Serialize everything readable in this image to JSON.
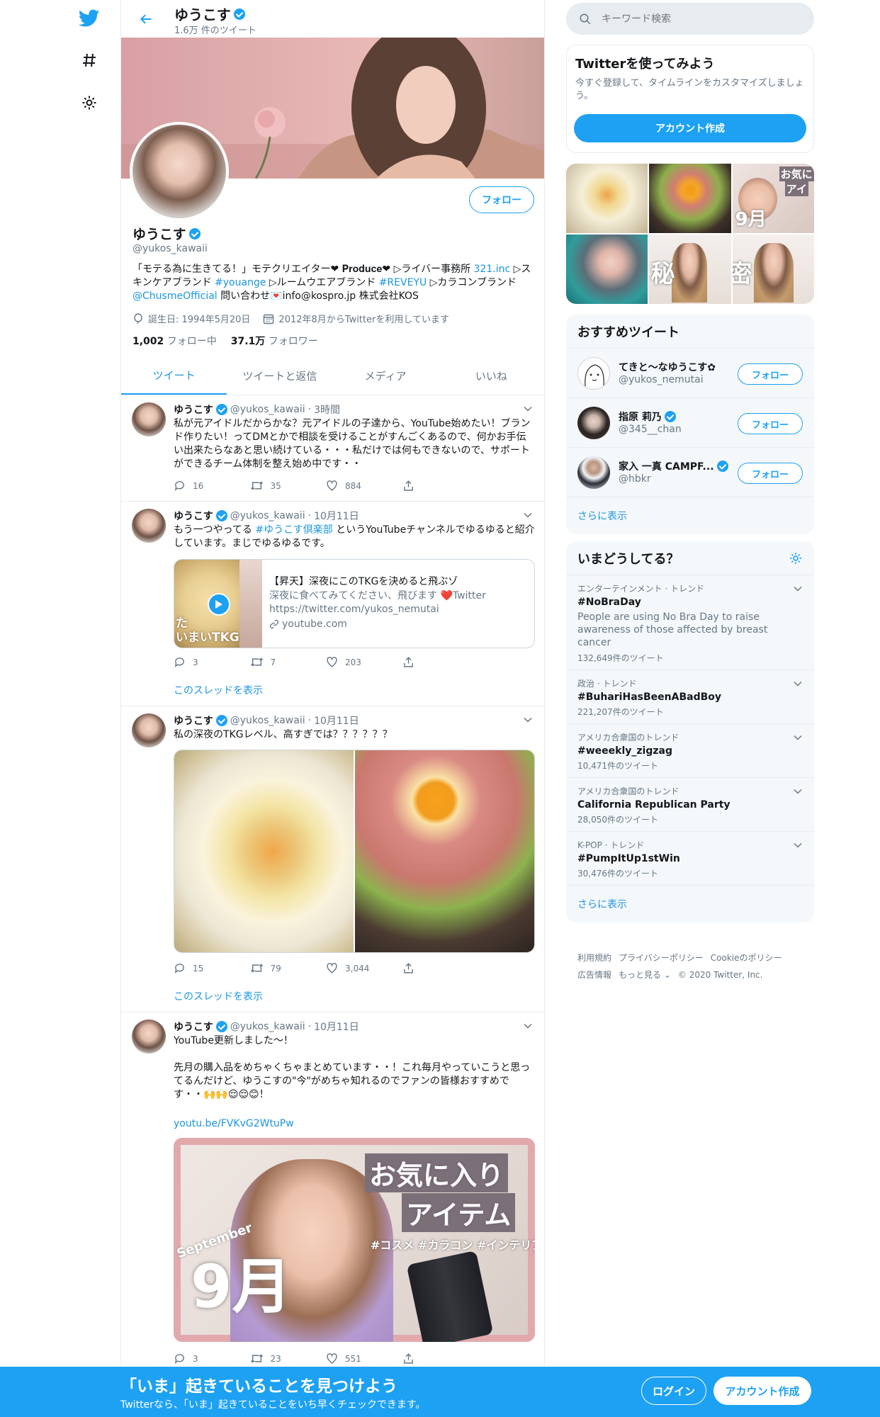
{
  "colors": {
    "accent": "#1da1f2",
    "link": "#1b95e0",
    "muted": "#657786",
    "border": "#e6ecf0"
  },
  "nav": {
    "icons": [
      "twitter-bird-icon",
      "hashtag-icon",
      "gear-icon"
    ]
  },
  "header": {
    "name": "ゆうこす",
    "tweet_count": "1.6万 件のツイート"
  },
  "profile": {
    "name": "ゆうこす",
    "handle": "@yukos_kawaii",
    "follow_label": "フォロー",
    "bio": {
      "p1": "「モテる為に生きてる！」モテクリエイター❤ 𝐏𝐫𝐨𝐝𝐮𝐜𝐞❤ ▷ライバー事務所 ",
      "l1": "321.inc",
      "p2": " ▷スキンケアブランド ",
      "l2": "#youange",
      "p3": " ▷ルームウエアブランド ",
      "l3": "#REVEYU",
      "p4": " ▷カラコンブランド ",
      "l4": "@ChusmeOfficial",
      "p5": " 問い合わせ💌info@kospro.jp 株式会社KOS"
    },
    "birthday": "誕生日: 1994年5月20日",
    "joined": "2012年8月からTwitterを利用しています",
    "following_count": "1,002",
    "following_label": "フォロー中",
    "followers_count": "37.1万",
    "followers_label": "フォロワー"
  },
  "tabs": [
    "ツイート",
    "ツイートと返信",
    "メディア",
    "いいね"
  ],
  "tweets": [
    {
      "name": "ゆうこす",
      "handle": "@yukos_kawaii",
      "time": "3時間",
      "text": "私が元アイドルだからかな？元アイドルの子達から、YouTube始めたい！ブランド作りたい！ってDMとかで相談を受けることがすんごくあるので、何かお手伝い出来たらなあと思い続けている・・・私だけでは何もできないので、サポートができるチーム体制を整え始め中です・・",
      "replies": "16",
      "retweets": "35",
      "likes": "884"
    },
    {
      "name": "ゆうこす",
      "handle": "@yukos_kawaii",
      "time": "10月11日",
      "text_a": "もう一つやってる ",
      "text_link": "#ゆうこす倶楽部",
      "text_b": " というYouTubeチャンネルでゆるゆると紹介しています。まじでゆるゆるです。",
      "card": {
        "title": "【昇天】深夜にこのTKGを決めると飛ぶゾ",
        "desc": "深夜に食べてみてください、飛びます ❤️Twitter https://twitter.com/yukos_nemutai",
        "domain": "youtube.com",
        "thumb_text_a": "た",
        "thumb_text_b": "いまいTKG"
      },
      "replies": "3",
      "retweets": "7",
      "likes": "203",
      "thread": "このスレッドを表示"
    },
    {
      "name": "ゆうこす",
      "handle": "@yukos_kawaii",
      "time": "10月11日",
      "text": "私の深夜のTKGレベル、高すぎでは？？？？？？",
      "replies": "15",
      "retweets": "79",
      "likes": "3,044",
      "thread": "このスレッドを表示"
    },
    {
      "name": "ゆうこす",
      "handle": "@yukos_kawaii",
      "time": "10月11日",
      "line1": "YouTube更新しました〜！",
      "line2": "先月の購入品をめちゃくちゃまとめています・・！これ毎月やっていこうと思ってるんだけど、ゆうこすの\"今\"がめちゃ知れるのでファンの皆様おすすめです・・🙌🙌😌😌😊！",
      "link": "youtu.be/FVKvG2WtuPw",
      "image": {
        "title_a": "お気に入り",
        "title_b": "アイテム",
        "tags": "#コスメ #カラコン #インテリア",
        "month_en": "September",
        "month": "9月"
      },
      "replies": "3",
      "retweets": "23",
      "likes": "551"
    }
  ],
  "right": {
    "search_placeholder": "キーワード検索",
    "signup": {
      "title": "Twitterを使ってみよう",
      "desc": "今すぐ登録して、タイムラインをカスタマイズしましょう。",
      "button": "アカウント作成"
    },
    "media_labels": {
      "m3a": "お気に",
      "m3b": "アイ",
      "m3c": "9月",
      "m5": "秘",
      "m5b": "密"
    },
    "who": {
      "title": "おすすめツイート",
      "items": [
        {
          "name": "てきと〜なゆうこす✿",
          "handle": "@yukos_nemutai",
          "verified": false,
          "button": "フォロー"
        },
        {
          "name": "指原 莉乃",
          "handle": "@345__chan",
          "verified": true,
          "button": "フォロー"
        },
        {
          "name": "家入 一真 CAMPF...",
          "handle": "@hbkr",
          "verified": true,
          "button": "フォロー"
        }
      ],
      "more": "さらに表示"
    },
    "trends": {
      "title": "いまどうしてる？",
      "items": [
        {
          "cat": "エンターテインメント · トレンド",
          "name": "#NoBraDay",
          "desc": "People are using No Bra Day to raise awareness of those affected by breast cancer",
          "count": "132,649件のツイート"
        },
        {
          "cat": "政治 · トレンド",
          "name": "#BuhariHasBeenABadBoy",
          "count": "221,207件のツイート"
        },
        {
          "cat": "アメリカ合衆国のトレンド",
          "name": "#weeekly_zigzag",
          "count": "10,471件のツイート"
        },
        {
          "cat": "アメリカ合衆国のトレンド",
          "name": "California Republican Party",
          "count": "28,050件のツイート"
        },
        {
          "cat": "K-POP · トレンド",
          "name": "#PumpItUp1stWin",
          "count": "30,476件のツイート"
        }
      ],
      "more": "さらに表示"
    },
    "footer": [
      "利用規約",
      "プライバシーポリシー",
      "Cookieのポリシー",
      "広告情報",
      "もっと見る ⌄",
      "© 2020 Twitter, Inc."
    ]
  },
  "bottom": {
    "title": "「いま」起きていることを見つけよう",
    "sub": "Twitterなら、「いま」起きていることをいち早くチェックできます。",
    "login": "ログイン",
    "signup": "アカウント作成"
  }
}
